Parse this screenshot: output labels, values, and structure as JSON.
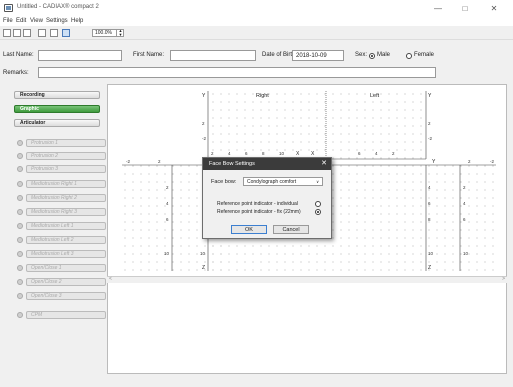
{
  "window": {
    "title": "Untitled - CADIAX® compact 2"
  },
  "menu": [
    "File",
    "Edit",
    "View",
    "Settings",
    "Help"
  ],
  "toolbar": {
    "zoom": "100.0%"
  },
  "patient": {
    "last_name_label": "Last Name:",
    "last_name_value": "",
    "first_name_label": "First Name:",
    "first_name_value": "",
    "dob_label": "Date of Birth:",
    "dob_value": "2018-10-09",
    "sex_label": "Sex:",
    "sex_options": [
      "Male",
      "Female"
    ],
    "sex_selected": "Male",
    "remarks_label": "Remarks:",
    "remarks_value": ""
  },
  "nav": {
    "recording": "Recording",
    "graphic": "Graphic",
    "articulator": "Articulator"
  },
  "tests": [
    "Protrusion 1",
    "Protrusion 2",
    "Protrusion 3",
    "Mediotrusion Right 1",
    "Mediotrusion Right 2",
    "Mediotrusion Right 3",
    "Mediotrusion Left 1",
    "Mediotrusion Left 2",
    "Mediotrusion Left 3",
    "Open/Close 1",
    "Open/Close 2",
    "Open/Close 3",
    "CPM"
  ],
  "graphic": {
    "right_label": "Right",
    "left_label": "Left",
    "axis_x": "X",
    "axis_y": "Y",
    "axis_z": "Z"
  },
  "dialog": {
    "title": "Face Bow Settings",
    "facebow_label": "Face bow:",
    "facebow_value": "Condylograph comfort",
    "ref_individual": "Reference point indicator - individual",
    "ref_fix": "Reference point indicator - fix (22mm)",
    "ok": "OK",
    "cancel": "Cancel"
  }
}
